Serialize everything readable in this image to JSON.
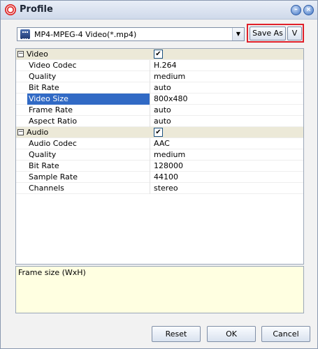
{
  "window": {
    "title": "Profile",
    "icon": "app-icon",
    "minimize_icon": "minimize-icon",
    "close_icon": "close-icon"
  },
  "profile_select": {
    "value": "MP4-MPEG-4 Video(*.mp4)",
    "icon": "video-file-icon"
  },
  "save_as_button": "Save As",
  "save_as_menu_button": "V",
  "properties": {
    "video": {
      "label": "Video",
      "enabled": true,
      "rows": [
        {
          "name": "Video Codec",
          "value": "H.264"
        },
        {
          "name": "Quality",
          "value": "medium"
        },
        {
          "name": "Bit Rate",
          "value": "auto"
        },
        {
          "name": "Video Size",
          "value": "800x480",
          "selected": true
        },
        {
          "name": "Frame Rate",
          "value": "auto"
        },
        {
          "name": "Aspect Ratio",
          "value": "auto"
        }
      ]
    },
    "audio": {
      "label": "Audio",
      "enabled": true,
      "rows": [
        {
          "name": "Audio Codec",
          "value": "AAC"
        },
        {
          "name": "Quality",
          "value": "medium"
        },
        {
          "name": "Bit Rate",
          "value": "128000"
        },
        {
          "name": "Sample Rate",
          "value": "44100"
        },
        {
          "name": "Channels",
          "value": "stereo"
        }
      ]
    }
  },
  "description": "Frame size (WxH)",
  "buttons": {
    "reset": "Reset",
    "ok": "OK",
    "cancel": "Cancel"
  },
  "colors": {
    "selection": "#316ac5",
    "category_bg": "#ece9d8",
    "description_bg": "#ffffe1",
    "highlight": "#e0202a"
  }
}
